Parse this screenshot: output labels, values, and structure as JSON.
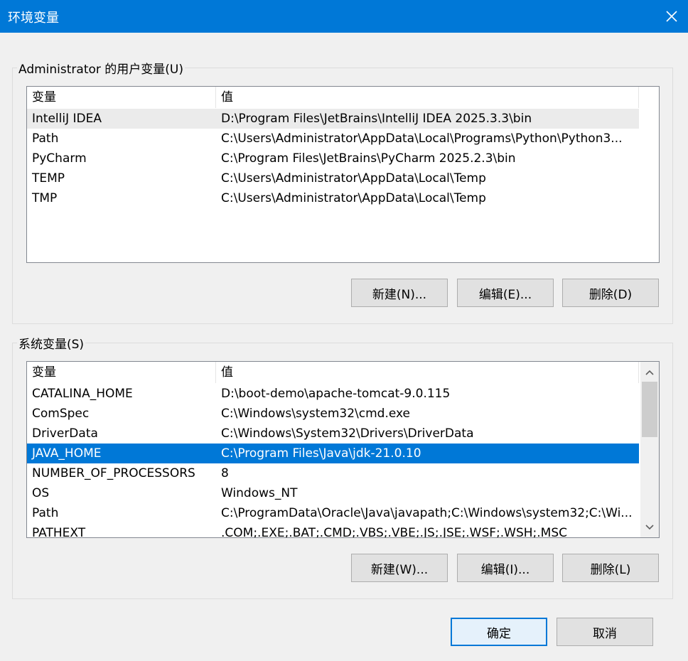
{
  "window": {
    "title": "环境变量",
    "close_icon": "close-icon"
  },
  "user_vars": {
    "group_label": "Administrator 的用户变量(U)",
    "columns": [
      "变量",
      "值"
    ],
    "rows": [
      {
        "name": "IntelliJ IDEA",
        "value": "D:\\Program Files\\JetBrains\\IntelliJ IDEA 2025.3.3\\bin"
      },
      {
        "name": "Path",
        "value": "C:\\Users\\Administrator\\AppData\\Local\\Programs\\Python\\Python3..."
      },
      {
        "name": "PyCharm",
        "value": "C:\\Program Files\\JetBrains\\PyCharm 2025.2.3\\bin"
      },
      {
        "name": "TEMP",
        "value": "C:\\Users\\Administrator\\AppData\\Local\\Temp"
      },
      {
        "name": "TMP",
        "value": "C:\\Users\\Administrator\\AppData\\Local\\Temp"
      }
    ],
    "buttons": {
      "new": "新建(N)...",
      "edit": "编辑(E)...",
      "delete": "删除(D)"
    }
  },
  "system_vars": {
    "group_label": "系统变量(S)",
    "columns": [
      "变量",
      "值"
    ],
    "rows": [
      {
        "name": "CATALINA_HOME",
        "value": "D:\\boot-demo\\apache-tomcat-9.0.115"
      },
      {
        "name": "ComSpec",
        "value": "C:\\Windows\\system32\\cmd.exe"
      },
      {
        "name": "DriverData",
        "value": "C:\\Windows\\System32\\Drivers\\DriverData"
      },
      {
        "name": "JAVA_HOME",
        "value": "C:\\Program Files\\Java\\jdk-21.0.10"
      },
      {
        "name": "NUMBER_OF_PROCESSORS",
        "value": "8"
      },
      {
        "name": "OS",
        "value": "Windows_NT"
      },
      {
        "name": "Path",
        "value": "C:\\ProgramData\\Oracle\\Java\\javapath;C:\\Windows\\system32;C:\\Wi..."
      },
      {
        "name": "PATHEXT",
        "value": ".COM;.EXE;.BAT;.CMD;.VBS;.VBE;.JS;.JSE;.WSF;.WSH;.MSC"
      }
    ],
    "selected_row": "JAVA_HOME",
    "buttons": {
      "new": "新建(W)...",
      "edit": "编辑(I)...",
      "delete": "删除(L)"
    }
  },
  "footer": {
    "ok": "确定",
    "cancel": "取消"
  },
  "colors": {
    "titlebar": "#0078d7",
    "selection": "#0078d7"
  }
}
